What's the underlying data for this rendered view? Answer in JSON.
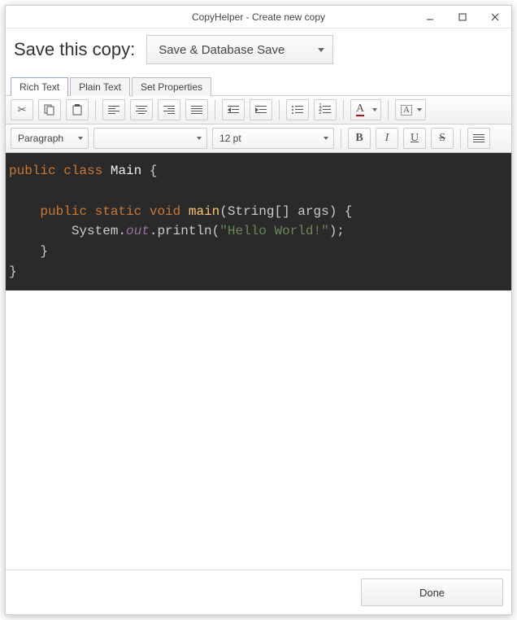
{
  "window": {
    "title": "CopyHelper - Create new copy"
  },
  "header": {
    "label": "Save this copy:",
    "save_dropdown": "Save & Database Save"
  },
  "tabs": [
    "Rich Text",
    "Plain Text",
    "Set Properties"
  ],
  "active_tab": 0,
  "toolbar1": {
    "cut": "cut-icon",
    "copy": "copy-icon",
    "paste": "paste-icon",
    "align_left": "align-left-icon",
    "align_center": "align-center-icon",
    "align_right": "align-right-icon",
    "align_justify": "align-justify-icon",
    "outdent": "outdent-icon",
    "indent": "indent-icon",
    "bullets": "bullet-list-icon",
    "numbers": "number-list-icon",
    "fontcolor_label": "A",
    "highlight_label": "A"
  },
  "toolbar2": {
    "para_style": "Paragraph",
    "font_family": "",
    "font_size": "12 pt",
    "bold": "B",
    "italic": "I",
    "underline": "U",
    "strike": "S",
    "justify": "align-justify-icon"
  },
  "code": {
    "line1": {
      "kw1": "public",
      "kw2": "class",
      "cls": "Main",
      "b": "{"
    },
    "line2": {
      "kw1": "public",
      "kw2": "static",
      "kw3": "void",
      "fn": "main",
      "args": "(String[] args) {"
    },
    "line3": {
      "pre": "System.",
      "fld": "out",
      "mid": ".println(",
      "str": "\"Hello World!\"",
      "end": ");"
    },
    "brace_close1": "}",
    "brace_close2": "}"
  },
  "footer": {
    "done": "Done"
  }
}
